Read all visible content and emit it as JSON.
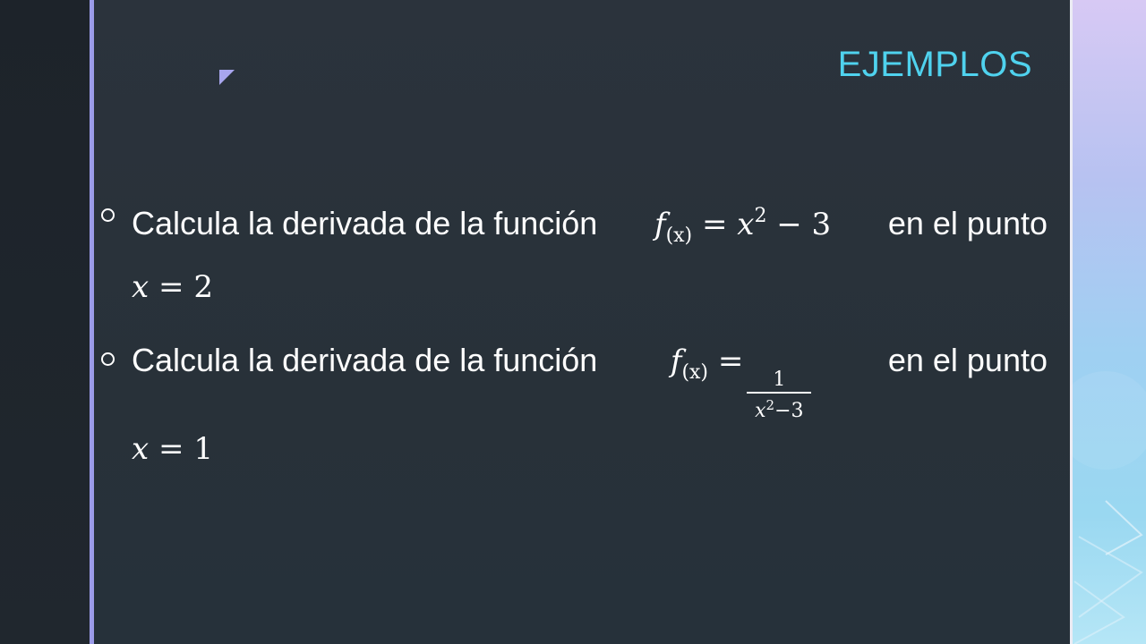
{
  "title": "EJEMPLOS",
  "bullets": [
    {
      "text_before": "Calcula la derivada de la función",
      "function": {
        "name": "f",
        "arg": "(x)",
        "equals": "=",
        "expr_base": "x",
        "expr_exp": "2",
        "expr_rest": "− 3"
      },
      "text_after": "en el punto",
      "point": {
        "var": "x",
        "equals": "=",
        "value": "2"
      }
    },
    {
      "text_before": "Calcula la derivada de la función",
      "function": {
        "name": "f",
        "arg": "(x)",
        "equals": "=",
        "numerator": "1",
        "den_base": "x",
        "den_exp": "2",
        "den_rest": "−3"
      },
      "text_after": "en el punto",
      "point": {
        "var": "x",
        "equals": "=",
        "value": "1"
      }
    }
  ],
  "colors": {
    "title": "#4fd2ee",
    "accent": "#9b9be8",
    "background": "#2b333c",
    "text": "#ffffff"
  }
}
